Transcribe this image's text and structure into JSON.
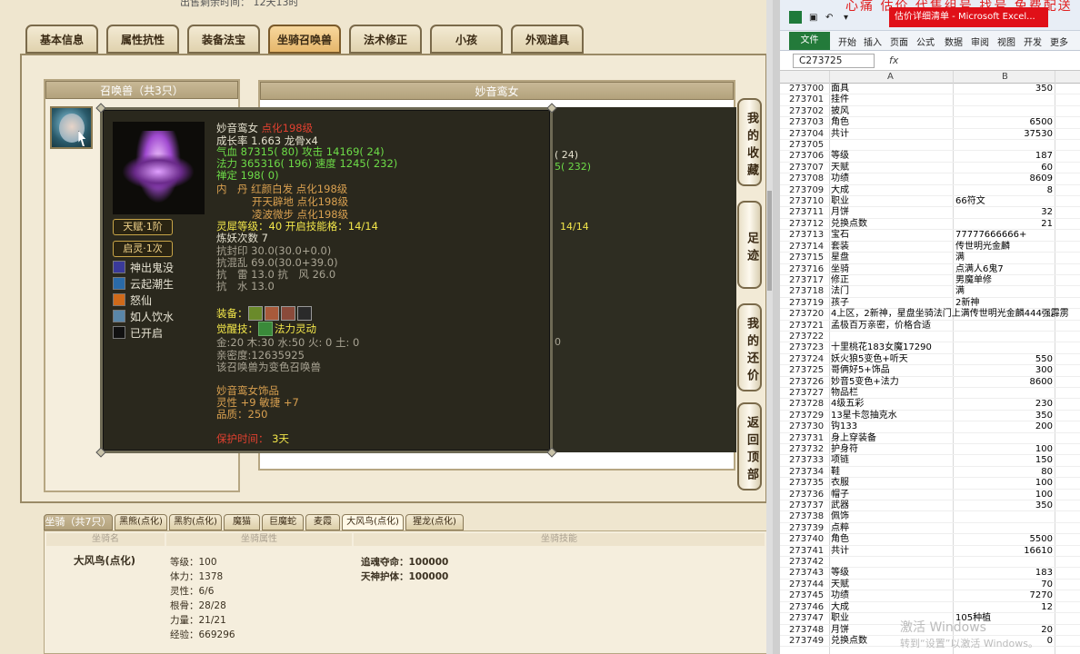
{
  "app": {
    "top_line": "出售剩余时间：  12天13时"
  },
  "tabs": [
    "基本信息",
    "属性抗性",
    "装备法宝",
    "坐骑召唤兽",
    "法术修正",
    "小孩",
    "外观道具"
  ],
  "pet_list": {
    "title": "召唤兽（共3只）"
  },
  "detail": {
    "title": "妙音鸾女"
  },
  "background_lines": {
    "l1": "( 24)",
    "l2": "5( 232)",
    "l3": "14/14",
    "l4": "0"
  },
  "side_buttons": [
    "我的收藏",
    "足迹",
    "我的还价",
    "返回顶部"
  ],
  "tooltip": {
    "name": "妙音鸾女",
    "name_suffix": "点化198级",
    "growth": "成长率 1.663 龙骨x4",
    "hp": "气血 87315( 80) 攻击 14169( 24)",
    "mp": "法力 365316( 196) 速度 1245( 232)",
    "calm": "禅定 198( 0)",
    "inner1": "内　丹 红颜白发 点化198级",
    "inner2": "开天辟地 点化198级",
    "inner3": "凌波微步 点化198级",
    "spirit": "灵犀等级：40 开启技能格：14/14",
    "refine": "炼妖次数 7",
    "r1": "抗封印 30.0(30.0+0.0)",
    "r2": "抗混乱 69.0(30.0+39.0)",
    "r3": "抗　雷 13.0 抗　风 26.0",
    "r4": "抗　水 13.0",
    "equip_label": "装备：",
    "awaken_label": "觉醒技：",
    "awaken_skill": "法力灵动",
    "elements": "金:20 木:30 水:50 火: 0 土: 0",
    "intimacy": "亲密度:12635925",
    "note": "该召唤兽为变色召唤兽",
    "orn_title": "妙音鸾女饰品",
    "orn_stats": "灵性 +9 敏捷 +7",
    "orn_quality": "品质：250",
    "protect_label": "保护时间：",
    "protect_value": "3天",
    "badge1": "天赋·1阶",
    "badge2": "启灵·1次",
    "skills": [
      "神出鬼没",
      "云起潮生",
      "怒仙",
      "如人饮水",
      "已开启"
    ]
  },
  "mount": {
    "tab_title": "坐骑（共7只）",
    "tabs": [
      "黑熊(点化)",
      "黑豹(点化)",
      "魔猫",
      "巨魔蛇",
      "麦霞",
      "大风鸟(点化)",
      "猩龙(点化)"
    ],
    "col_name": "坐骑名",
    "col_attr": "坐骑属性",
    "col_skill": "坐骑技能",
    "name": "大风鸟(点化)",
    "attrs": [
      "等级：100",
      "体力：1378",
      "灵性：6/6",
      "根骨：28/28",
      "力量：21/21",
      "经验：669296"
    ],
    "skill1": "追魂夺命：100000",
    "skill2": "天神护体：100000"
  },
  "excel": {
    "header_red": "心痛 估价 代售组号 找号 免费配送",
    "title": "估价详细清单 - Microsoft Excel...",
    "ribbon": [
      "文件",
      "开始",
      "插入",
      "页面",
      "公式",
      "数据",
      "审阅",
      "视图",
      "开发",
      "更多"
    ],
    "cell_ref": "C273725",
    "fx": "fx",
    "col_a": "A",
    "col_b": "B",
    "rows": [
      [
        "273700",
        "面具",
        "350"
      ],
      [
        "273701",
        "挂件",
        ""
      ],
      [
        "273702",
        "披风",
        ""
      ],
      [
        "273703",
        "角色",
        "6500"
      ],
      [
        "273704",
        "共计",
        "37530"
      ],
      [
        "273705",
        "",
        ""
      ],
      [
        "273706",
        "等级",
        "187"
      ],
      [
        "273707",
        "天赋",
        "60"
      ],
      [
        "273708",
        "功绩",
        "8609"
      ],
      [
        "273709",
        "大成",
        "8"
      ],
      [
        "273710",
        "职业",
        "66符文",
        ""
      ],
      [
        "273711",
        "月饼",
        "32"
      ],
      [
        "273712",
        "兑换点数",
        "21"
      ],
      [
        "273713",
        "宝石",
        "77777666666+",
        ""
      ],
      [
        "273714",
        "套装",
        "传世明光金麟",
        ""
      ],
      [
        "273715",
        "星盘",
        "满",
        ""
      ],
      [
        "273716",
        "坐骑",
        "点满人6鬼7",
        ""
      ],
      [
        "273717",
        "修正",
        "男魔单修",
        ""
      ],
      [
        "273718",
        "法门",
        "满",
        ""
      ],
      [
        "273719",
        "孩子",
        "2新神",
        ""
      ],
      [
        "273720",
        "4上区，2新神，星盘坐骑法门上满传世明光金麟444强霹雳",
        ""
      ],
      [
        "273721",
        "孟极百万亲密，价格合适",
        ""
      ],
      [
        "273722",
        "",
        ""
      ],
      [
        "273723",
        "十里桃花183女魔17290",
        ""
      ],
      [
        "273724",
        "妖火狼5变色+听天",
        "550"
      ],
      [
        "273725",
        "哥俩好5+饰品",
        "300"
      ],
      [
        "273726",
        "妙音5变色+法力",
        "8600"
      ],
      [
        "273727",
        "物品栏",
        ""
      ],
      [
        "273728",
        "4级五彩",
        "230"
      ],
      [
        "273729",
        "13星卡忽抽克水",
        "350"
      ],
      [
        "273730",
        "钩133",
        "200"
      ],
      [
        "273731",
        "身上穿装备",
        ""
      ],
      [
        "273732",
        "护身符",
        "100"
      ],
      [
        "273733",
        "项链",
        "150"
      ],
      [
        "273734",
        "鞋",
        "80"
      ],
      [
        "273735",
        "衣服",
        "100"
      ],
      [
        "273736",
        "帽子",
        "100"
      ],
      [
        "273737",
        "武器",
        "350"
      ],
      [
        "273738",
        "佩饰",
        ""
      ],
      [
        "273739",
        "点粹",
        ""
      ],
      [
        "273740",
        "角色",
        "5500"
      ],
      [
        "273741",
        "共计",
        "16610"
      ],
      [
        "273742",
        "",
        ""
      ],
      [
        "273743",
        "等级",
        "183"
      ],
      [
        "273744",
        "天赋",
        "70"
      ],
      [
        "273745",
        "功绩",
        "7270"
      ],
      [
        "273746",
        "大成",
        "12"
      ],
      [
        "273747",
        "职业",
        "105种植",
        ""
      ],
      [
        "273748",
        "月饼",
        "20"
      ],
      [
        "273749",
        "兑换点数",
        "0"
      ]
    ],
    "watermark1": "激活 Windows",
    "watermark2": "转到“设置”以激活 Windows。"
  }
}
